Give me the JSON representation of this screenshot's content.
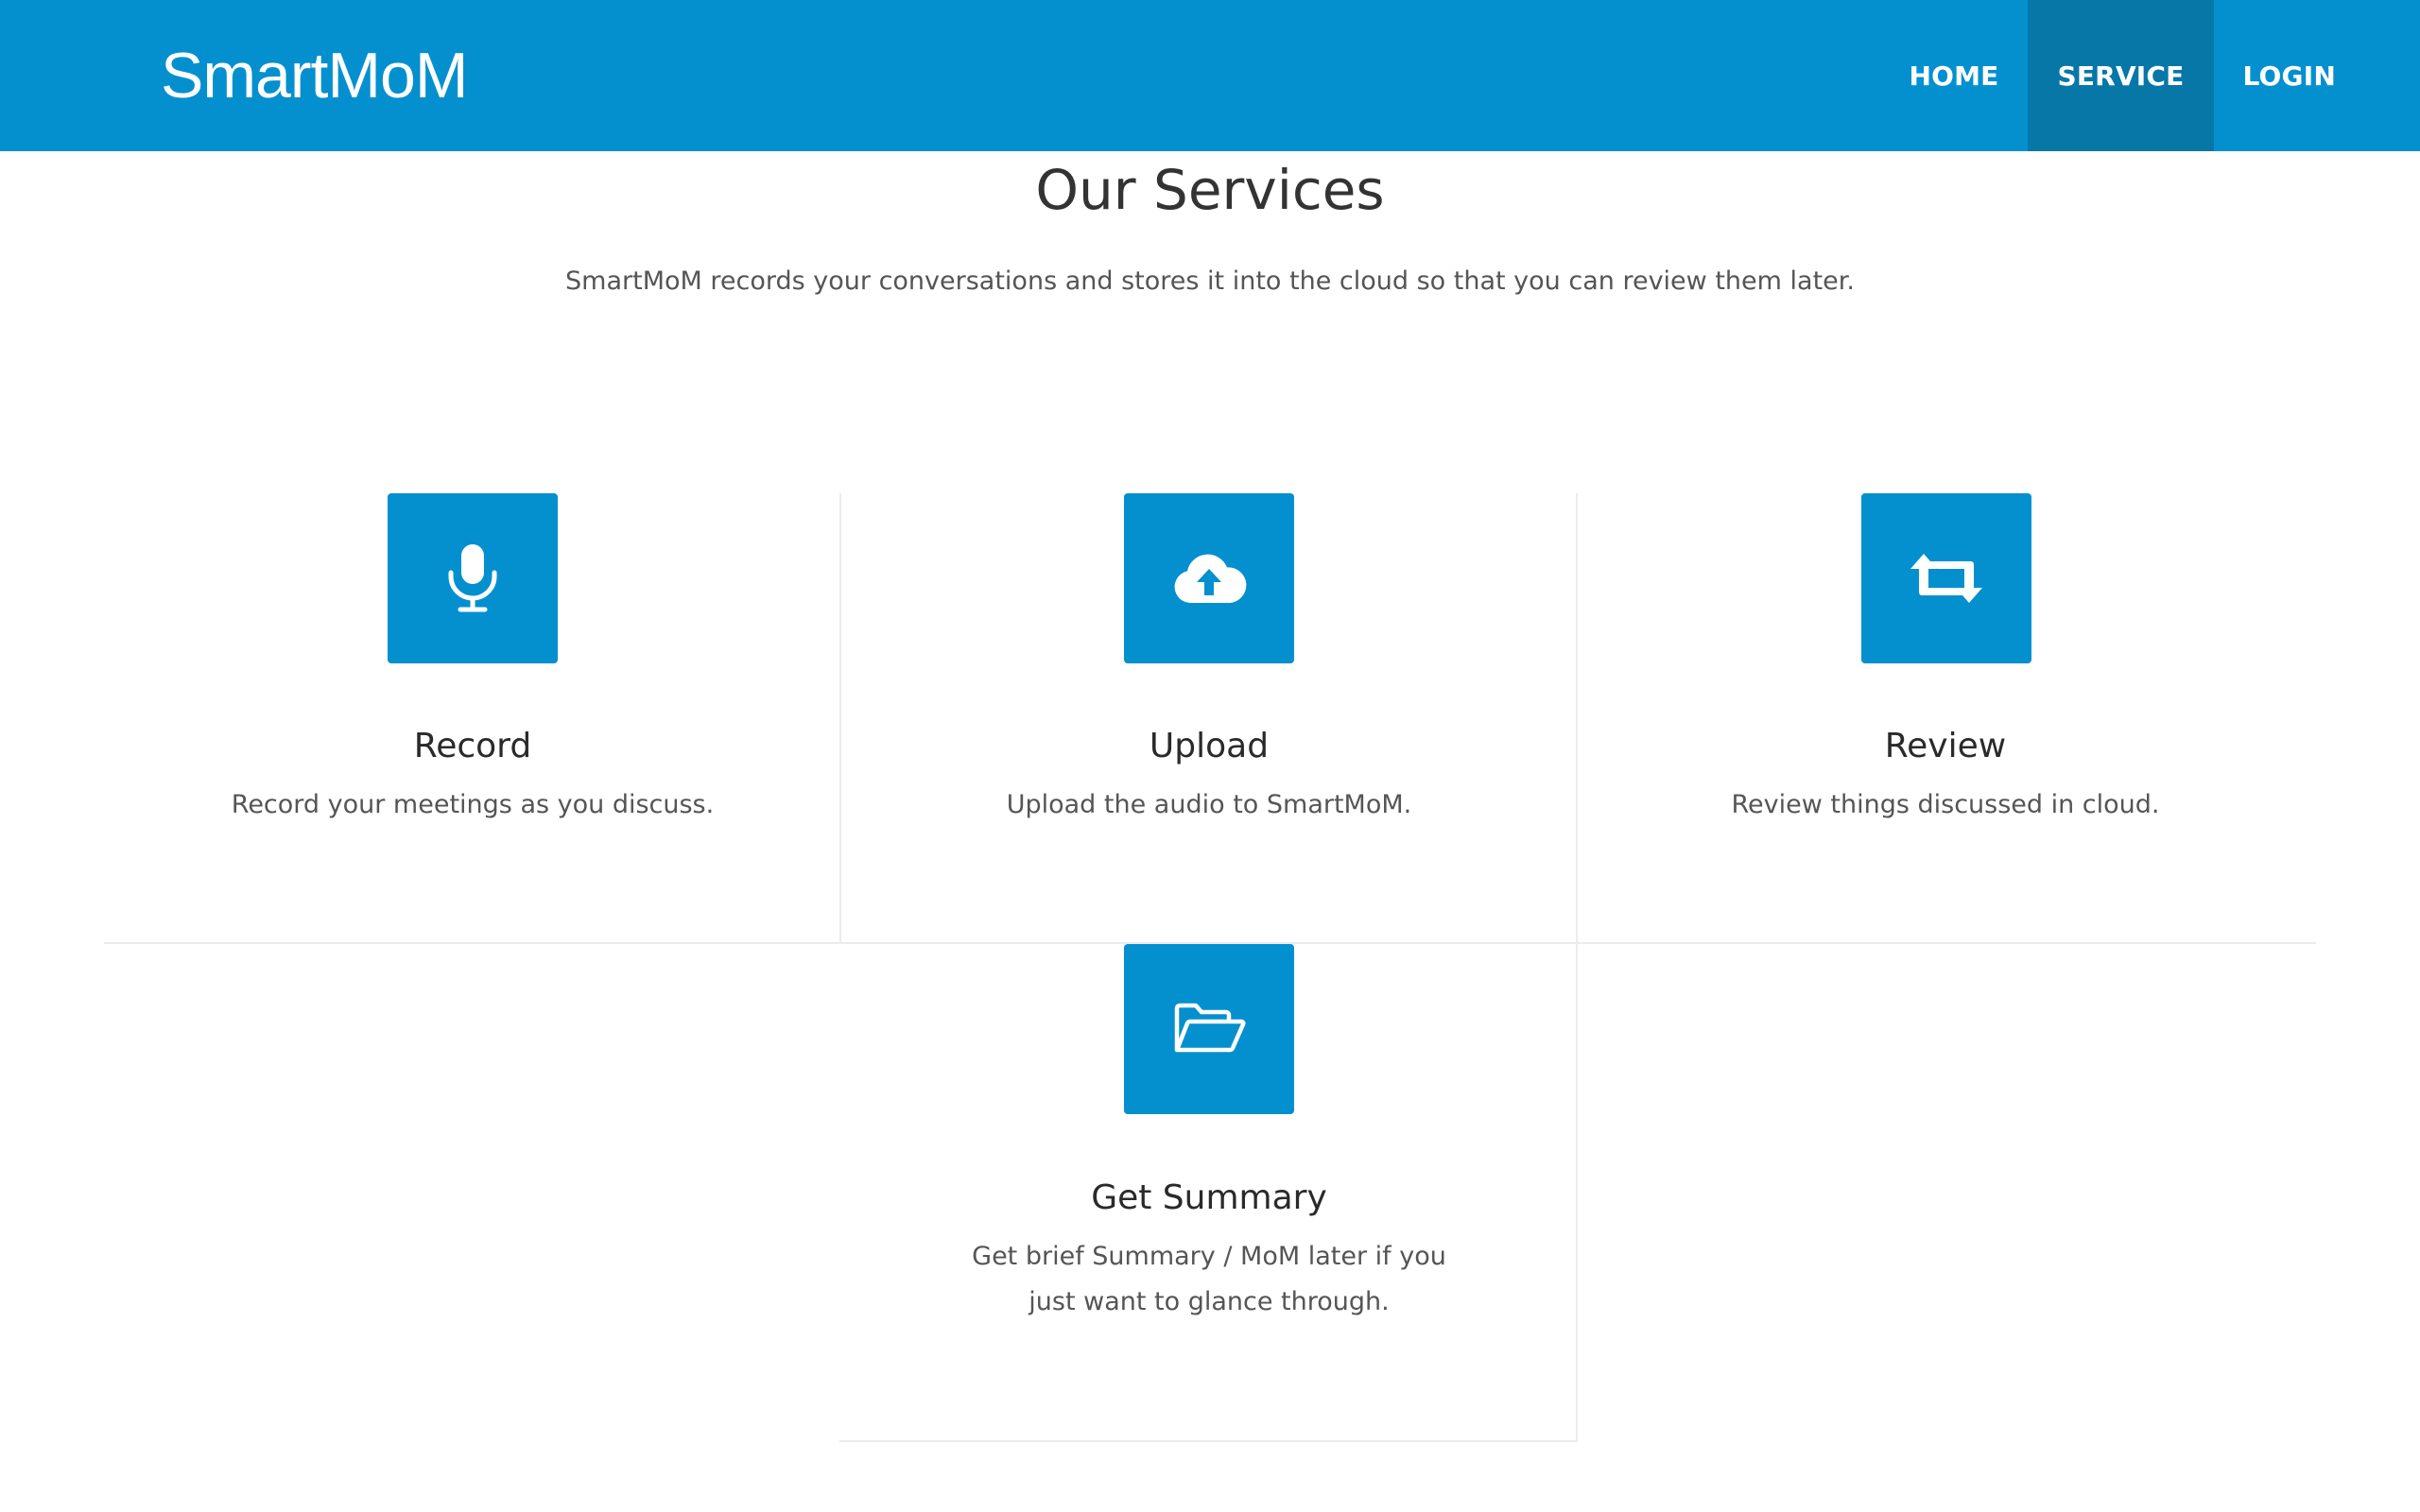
{
  "header": {
    "brand": "SmartMoM",
    "nav": [
      {
        "label": "HOME",
        "active": false
      },
      {
        "label": "SERVICE",
        "active": true
      },
      {
        "label": "LOGIN",
        "active": false
      }
    ]
  },
  "services_section": {
    "title": "Our Services",
    "subtitle": "SmartMoM records your conversations and stores it into the cloud so that you can review them later.",
    "items": [
      {
        "icon": "microphone-icon",
        "title": "Record",
        "description": "Record your meetings as you discuss."
      },
      {
        "icon": "cloud-upload-icon",
        "title": "Upload",
        "description": "Upload the audio to SmartMoM."
      },
      {
        "icon": "retweet-icon",
        "title": "Review",
        "description": "Review things discussed in cloud."
      },
      {
        "icon": "folder-open-icon",
        "title": "Get Summary",
        "description": "Get brief Summary / MoM later if you just want to glance through."
      }
    ]
  },
  "colors": {
    "primary": "#0490cf",
    "nav_active": "#0777a8",
    "text": "#333333",
    "muted_text": "#555555",
    "divider": "#ececec"
  }
}
